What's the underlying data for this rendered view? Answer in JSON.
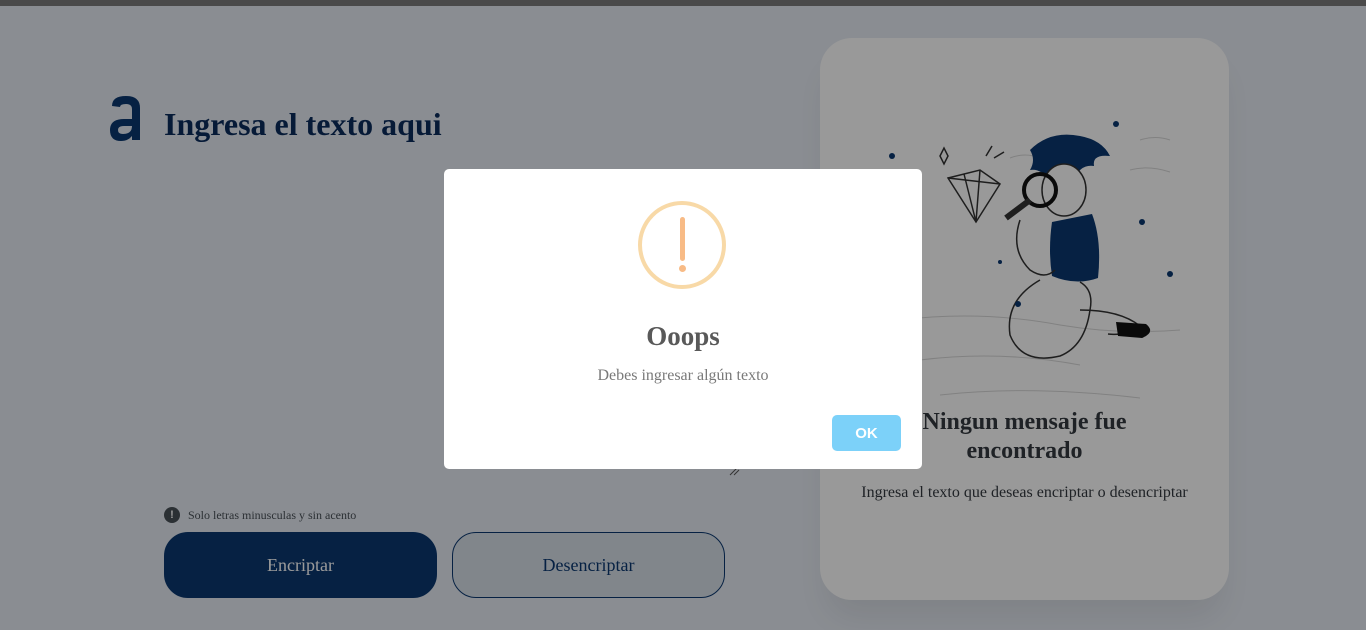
{
  "app": {
    "heading": "Ingresa el texto aqui",
    "input_placeholder": "",
    "hint": "Solo letras minusculas y sin acento",
    "hint_icon": "exclamation-circle-icon",
    "buttons": {
      "encrypt": "Encriptar",
      "decrypt": "Desencriptar"
    }
  },
  "result": {
    "title": "Ningun mensaje fue encontrado",
    "subtitle": "Ingresa el texto que deseas encriptar o desencriptar",
    "illustration": "person-with-magnifying-glass-illustration"
  },
  "alert": {
    "icon": "warning-icon",
    "title": "Ooops",
    "text": "Debes ingresar algún texto",
    "ok_label": "OK"
  },
  "colors": {
    "primary": "#0a3871",
    "background": "#e6ebf3",
    "warning": "#f8bb86",
    "ok_button": "#7cd1f9"
  }
}
